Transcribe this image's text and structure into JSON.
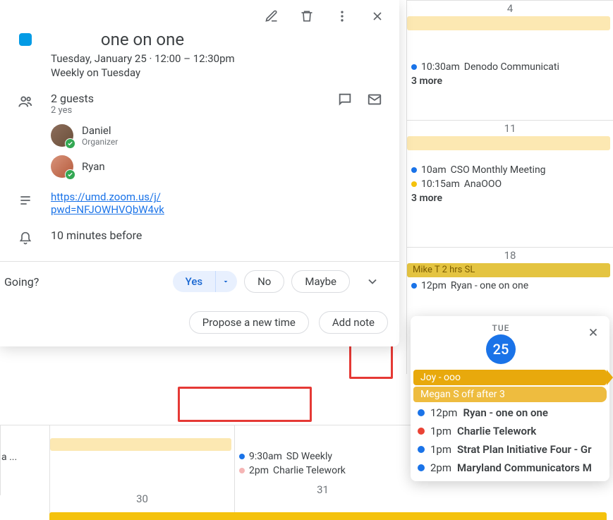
{
  "event": {
    "title": "one on one",
    "datetime": "Tuesday, January 25  ·  12:00 – 12:30pm",
    "recurrence": "Weekly on Tuesday",
    "guests_count": "2 guests",
    "guests_yes": "2 yes",
    "guests": [
      {
        "name": "Daniel",
        "role": "Organizer"
      },
      {
        "name": "Ryan",
        "role": ""
      }
    ],
    "link_line1": "https://umd.zoom.us/j/",
    "link_line2": "pwd=NFJOWHVQbW4vk",
    "reminder": "10 minutes before"
  },
  "rsvp": {
    "label": "Going?",
    "yes": "Yes",
    "no": "No",
    "maybe": "Maybe",
    "propose": "Propose a new time",
    "add_note": "Add note"
  },
  "grid": {
    "dates": {
      "d4": "4",
      "d11": "11",
      "d18": "18",
      "d30": "30",
      "d31": "31"
    },
    "bg_truncated": "a ...",
    "week1": {
      "evt1_time": "10:30am",
      "evt1_title": "Denodo Communicati",
      "more": "3 more"
    },
    "week2": {
      "evt1_time": "10am",
      "evt1_title": "CSO Monthly Meeting",
      "evt2_time": "10:15am",
      "evt2_title": "AnaOOO",
      "more": "3 more"
    },
    "week3": {
      "allday": "Mike T 2 hrs SL",
      "evt1_time": "12pm",
      "evt1_title": "Ryan - one on one"
    },
    "week4": {
      "monday": {
        "evt1_time": "9:30am",
        "evt1_title": "SD Weekly",
        "evt2_time": "2pm",
        "evt2_title": "Charlie Telework"
      }
    }
  },
  "day_popup": {
    "dow": "TUE",
    "day": "25",
    "allday1": "Joy - ooo",
    "allday2": "Megan S off after 3",
    "events": [
      {
        "dot": "blue",
        "time": "12pm",
        "title": "Ryan - one on one"
      },
      {
        "dot": "red",
        "time": "1pm",
        "title": "Charlie Telework"
      },
      {
        "dot": "blue",
        "time": "1pm",
        "title": "Strat Plan Initiative Four - Gr"
      },
      {
        "dot": "blue",
        "time": "2pm",
        "title": "Maryland Communicators M"
      }
    ]
  }
}
